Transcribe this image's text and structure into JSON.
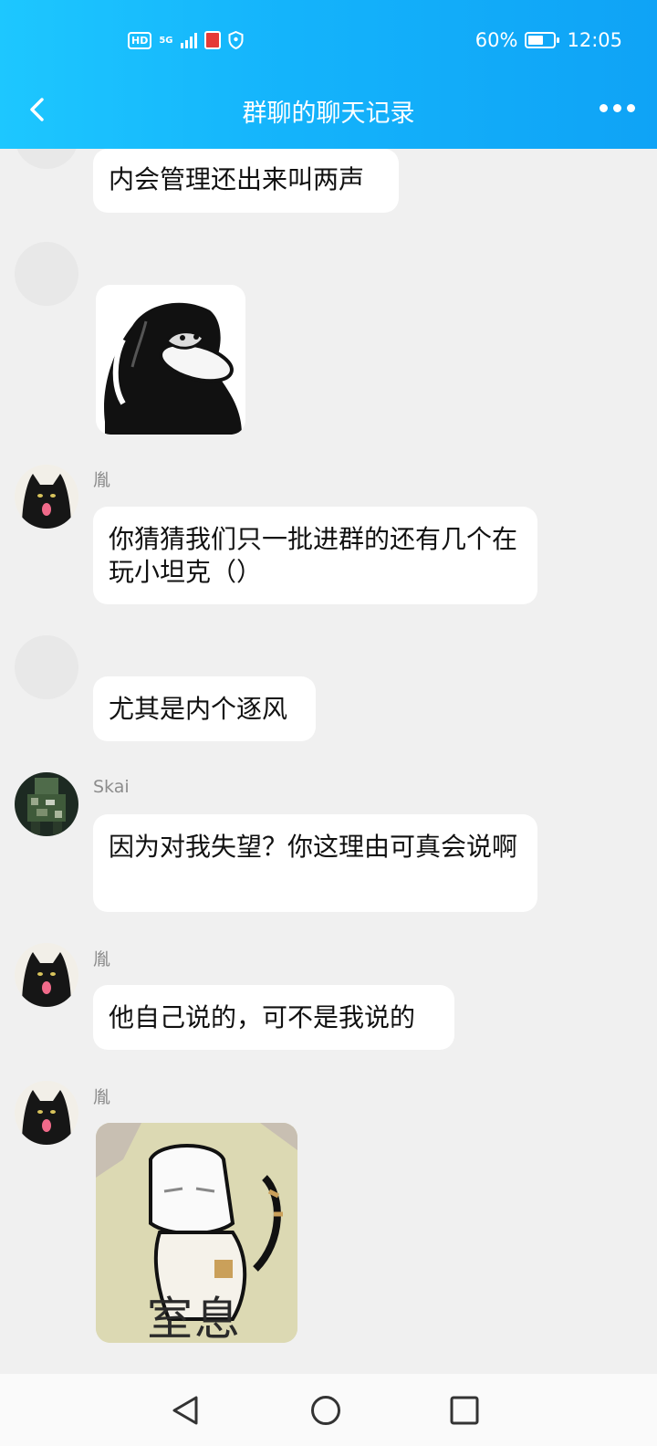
{
  "status_bar": {
    "hd": "HD",
    "network": "5G",
    "battery_percent": "60%",
    "battery_level": 0.6,
    "time": "12:05"
  },
  "header": {
    "title": "群聊的聊天记录",
    "back_icon": "chevron-left-icon",
    "more_icon": "more-dots-icon"
  },
  "messages": [
    {
      "sender": "",
      "text": "内会管理还出来叫两声"
    },
    {
      "sender": "",
      "sticker": "black-bird-sticker"
    },
    {
      "sender": "胤",
      "text": "你猜猜我们只一批进群的还有几个在玩小坦克（）"
    },
    {
      "sender": "",
      "text": "尤其是内个逐风"
    },
    {
      "sender": "Skai",
      "text": "因为对我失望？你这理由可真会说啊"
    },
    {
      "sender": "胤",
      "text": "他自己说的，可不是我说的"
    },
    {
      "sender": "胤",
      "sticker": "cat-sticker",
      "sticker_caption": "室息"
    }
  ],
  "nav_bar": {
    "back": "triangle-back-icon",
    "home": "circle-home-icon",
    "recents": "square-recents-icon"
  }
}
